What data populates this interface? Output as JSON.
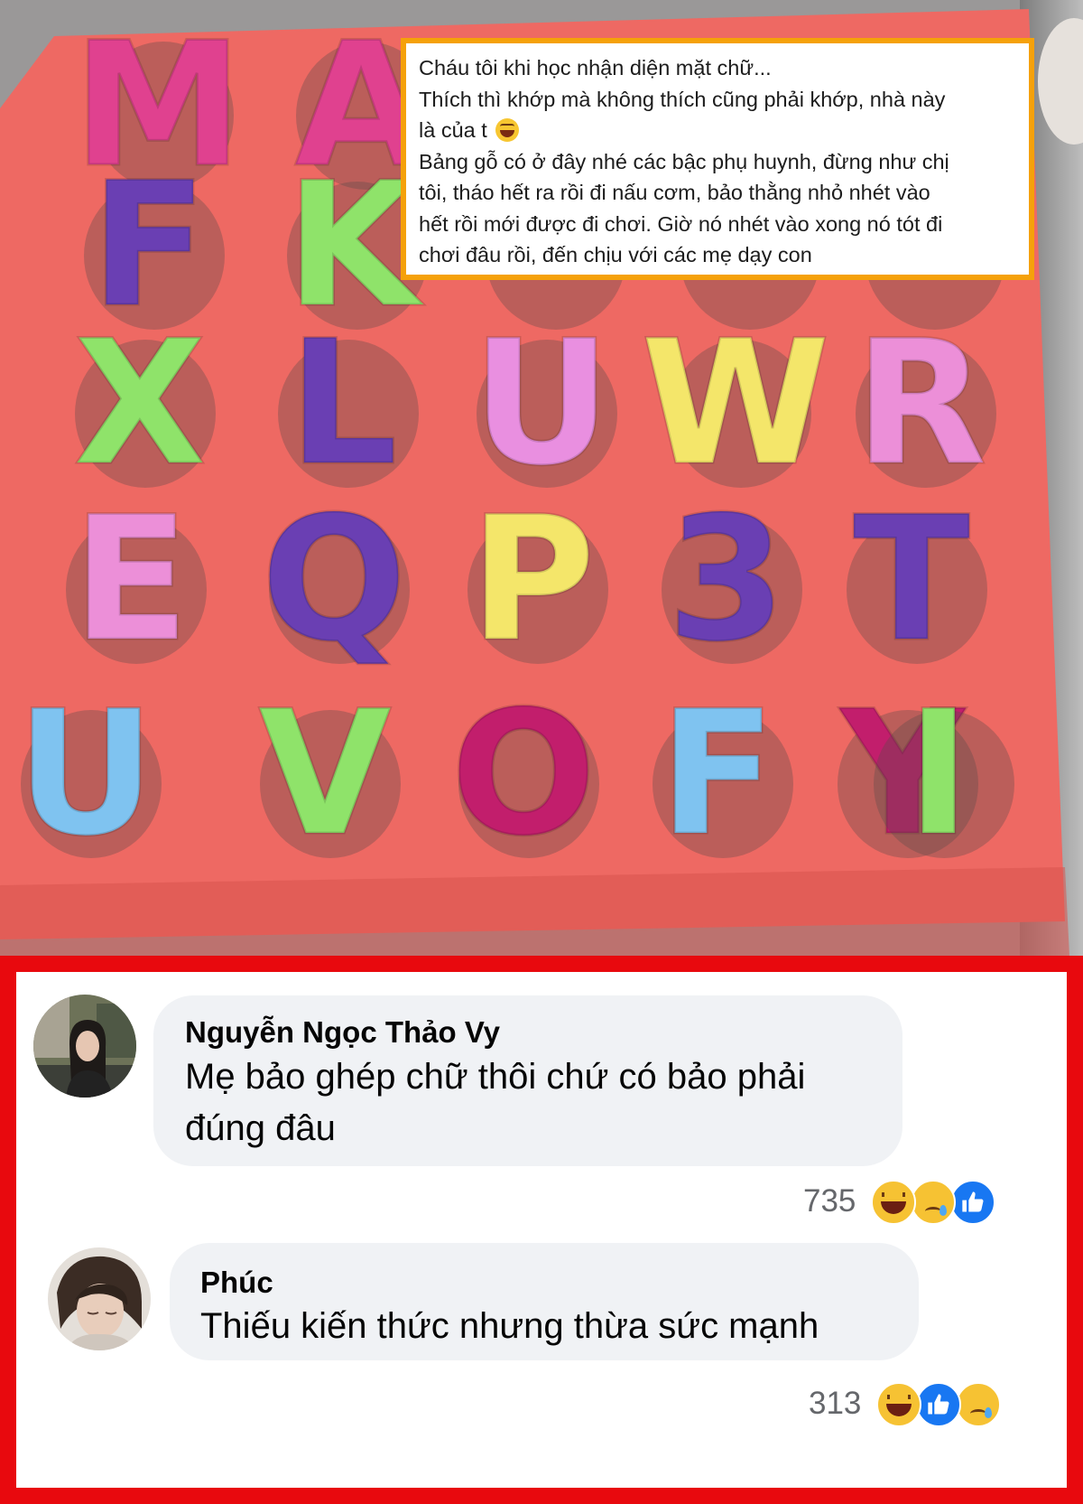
{
  "caption": {
    "lines": [
      "Cháu tôi khi học nhận diện mặt chữ...",
      "Thích thì khớp mà không thích cũng phải khớp, nhà này",
      "là của t",
      "Bảng gỗ có ở đây nhé các bậc phụ huynh, đừng như chị",
      "tôi, tháo hết ra rồi đi nấu cơm, bảo thằng nhỏ nhét vào",
      "hết rồi mới được đi chơi. Giờ nó nhét vào xong nó tót đi",
      "chơi đâu rồi, đến chịu với các mẹ dạy con"
    ],
    "emoji": "tears-of-joy-emoji"
  },
  "puzzle_letters": [
    "M",
    "A",
    "",
    "",
    "",
    "F",
    "K",
    "",
    "",
    "",
    "X",
    "L",
    "U",
    "W",
    "R",
    "E",
    "Q",
    "P",
    "3",
    "T",
    "U",
    "V",
    "O",
    "F",
    "Y",
    "I"
  ],
  "colors": {
    "board": "#ef6a64",
    "caption_border": "#f5a10a",
    "panel_border": "#e8090e",
    "bubble": "#f0f2f5",
    "like": "#1877f2"
  },
  "comments": [
    {
      "author": "Nguyễn Ngọc Thảo Vy",
      "text": "Mẹ bảo ghép chữ thôi chứ có bảo phải đúng đâu",
      "reaction_count": "735",
      "reactions": [
        "haha",
        "sad",
        "like"
      ]
    },
    {
      "author": "Phúc",
      "text": "Thiếu kiến thức nhưng thừa sức mạnh",
      "reaction_count": "313",
      "reactions": [
        "haha",
        "like",
        "sad"
      ]
    }
  ]
}
